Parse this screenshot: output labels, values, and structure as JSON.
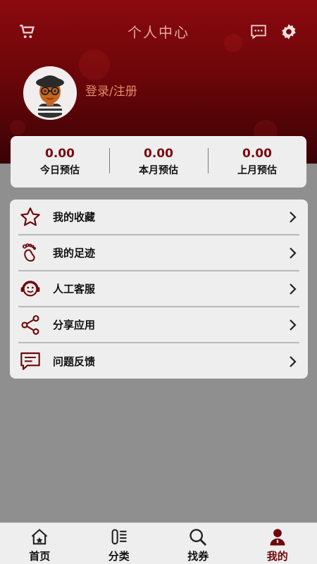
{
  "header": {
    "title": "个人中心",
    "login_text": "登录/注册"
  },
  "icons": {
    "cart": "cart-icon",
    "message": "message-icon",
    "settings": "gear-icon"
  },
  "stats": [
    {
      "value": "0.00",
      "label": "今日预估"
    },
    {
      "value": "0.00",
      "label": "本月预估"
    },
    {
      "value": "0.00",
      "label": "上月预估"
    }
  ],
  "menu": [
    {
      "label": "我的收藏",
      "icon": "star-icon"
    },
    {
      "label": "我的足迹",
      "icon": "footprint-icon"
    },
    {
      "label": "人工客服",
      "icon": "customer-service-icon"
    },
    {
      "label": "分享应用",
      "icon": "share-icon"
    },
    {
      "label": "问题反馈",
      "icon": "feedback-icon"
    }
  ],
  "tabs": [
    {
      "label": "首页",
      "icon": "home-icon"
    },
    {
      "label": "分类",
      "icon": "category-icon"
    },
    {
      "label": "找券",
      "icon": "search-icon"
    },
    {
      "label": "我的",
      "icon": "user-icon",
      "active": true
    }
  ],
  "colors": {
    "brand": "#7a0a10",
    "login_text": "#e8886a"
  }
}
